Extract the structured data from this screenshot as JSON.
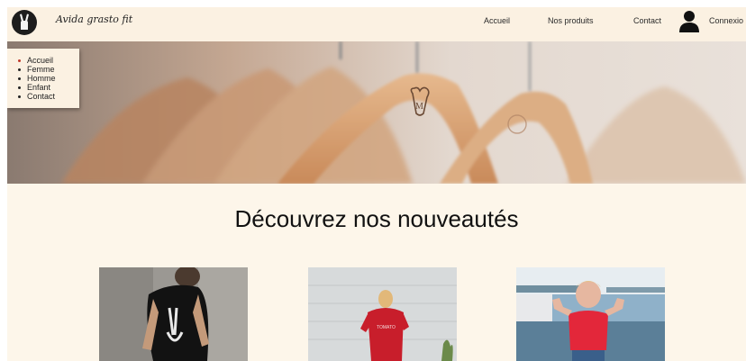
{
  "brand": {
    "name": "Avida grasto fit",
    "logo_icon": "peace-hand-icon"
  },
  "nav": {
    "items": [
      {
        "label": "Accueil"
      },
      {
        "label": "Nos produits"
      },
      {
        "label": "Contact"
      },
      {
        "label": "Connexio"
      }
    ],
    "account_icon": "user-icon"
  },
  "side_menu": {
    "items": [
      {
        "label": "Accueil",
        "active": true
      },
      {
        "label": "Femme"
      },
      {
        "label": "Homme"
      },
      {
        "label": "Enfant"
      },
      {
        "label": "Contact"
      }
    ]
  },
  "hero": {
    "image": "wooden-hangers-photo"
  },
  "section": {
    "title": "Découvrez nos nouveautés"
  },
  "products": [
    {
      "image": "man-skeleton-tshirt-photo"
    },
    {
      "image": "woman-red-tshirt-dress-photo"
    },
    {
      "image": "child-red-tshirt-photo"
    }
  ],
  "colors": {
    "background": "#fdf6ea",
    "header": "#fbf1e2",
    "accent": "#c0392b"
  }
}
